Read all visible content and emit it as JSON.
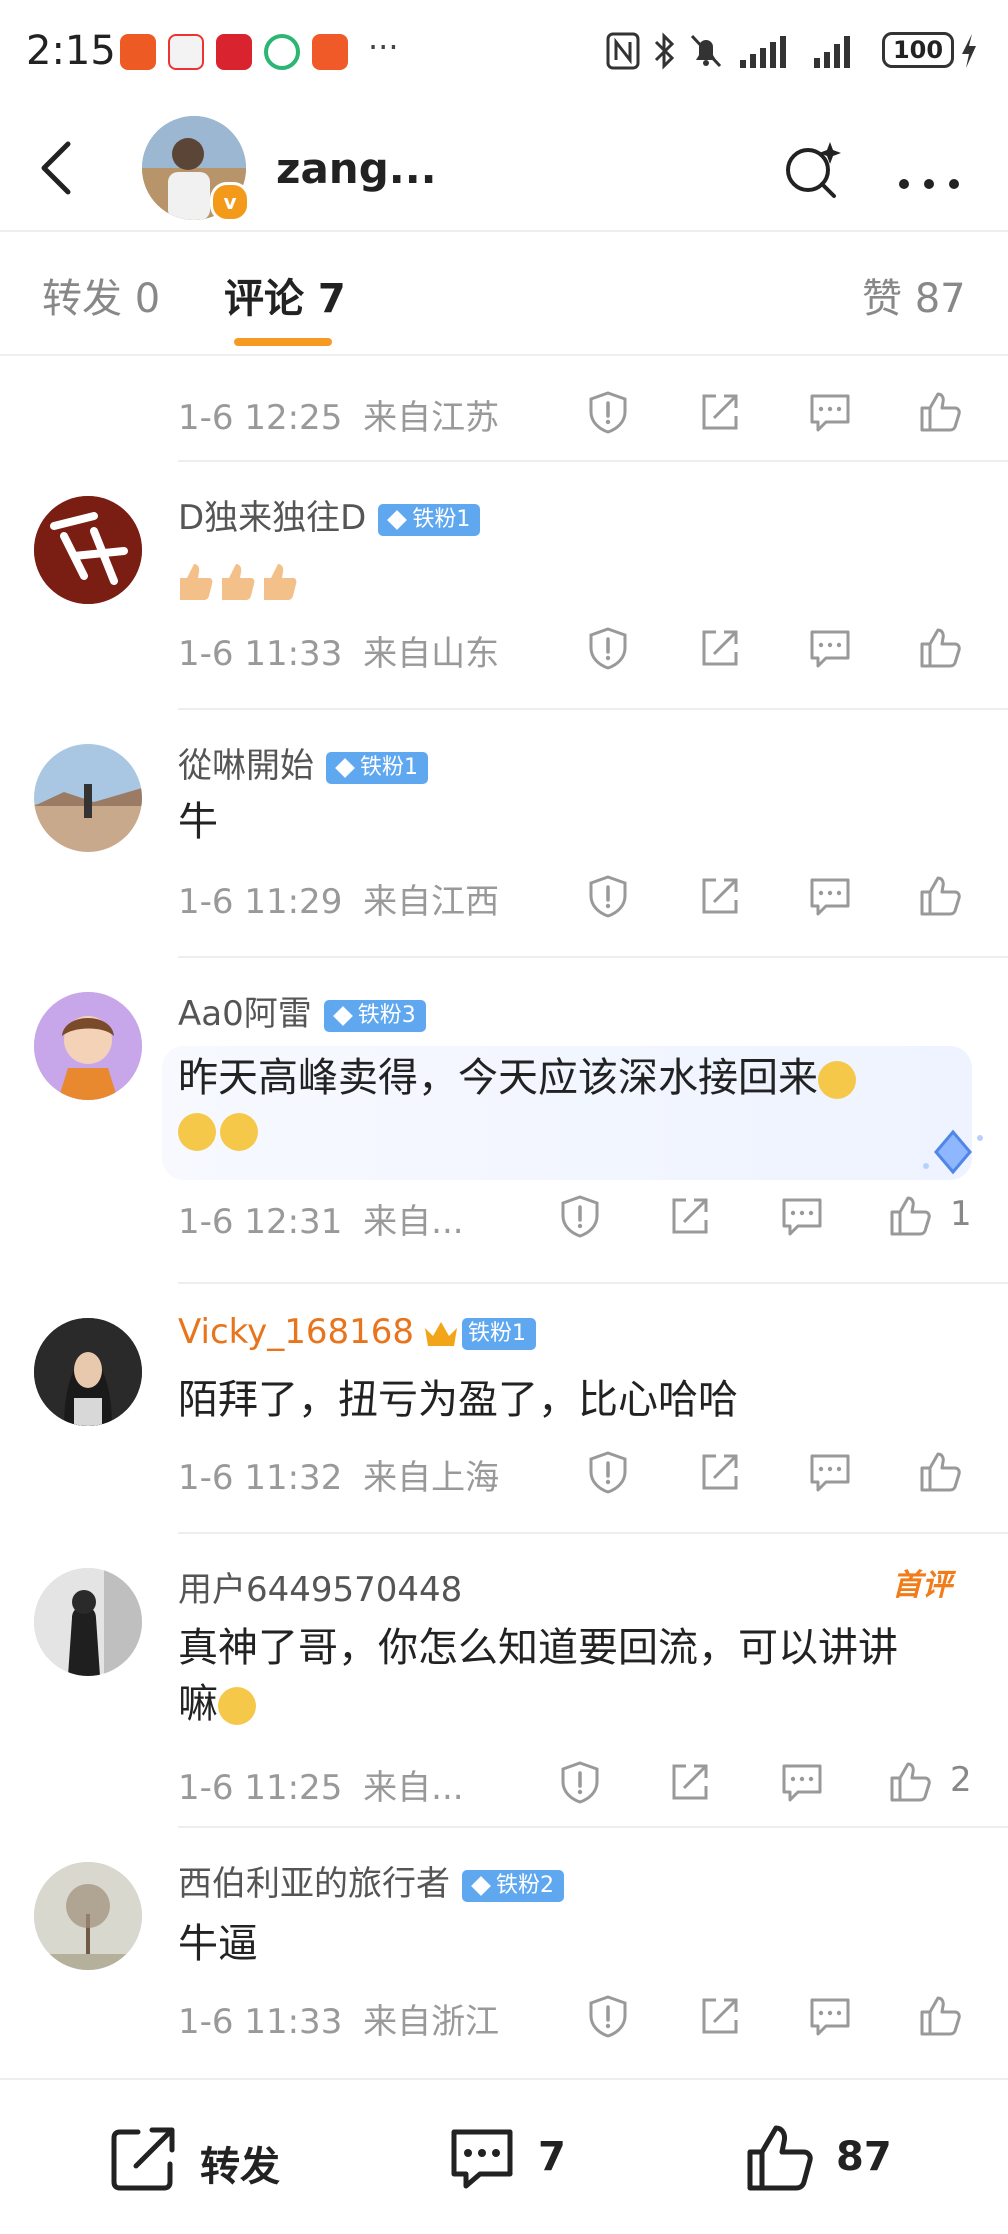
{
  "status_bar": {
    "time": "2:15",
    "more": "···",
    "battery": "100"
  },
  "header": {
    "username": "zang...",
    "verified": "v"
  },
  "tabs": [
    {
      "label": "转发 0"
    },
    {
      "label": "评论 7"
    },
    {
      "label": "赞 87"
    }
  ],
  "comments": [
    {
      "name": "",
      "text": "",
      "time": "1-6 12:25",
      "location": "来自江苏",
      "likes": ""
    },
    {
      "name": "D独来独往D",
      "fan": "铁粉1",
      "text": "",
      "time": "1-6 11:33",
      "location": "来自山东",
      "likes": ""
    },
    {
      "name": "從啉開始",
      "fan": "铁粉1",
      "text": "牛",
      "time": "1-6 11:29",
      "location": "来自江西",
      "likes": ""
    },
    {
      "name": "Aa0阿雷",
      "fan": "铁粉3",
      "text_line1": "昨天高峰卖得，今天应该深水接回来",
      "time": "1-6 12:31",
      "location": "来自...",
      "likes": "1"
    },
    {
      "name": "Vicky_168168",
      "fan": "铁粉1",
      "text": "陌拜了，扭亏为盈了，比心哈哈",
      "time": "1-6 11:32",
      "location": "来自上海",
      "likes": ""
    },
    {
      "name": "用户6449570448",
      "badge": "首评",
      "text_line1": "真神了哥，你怎么知道要回流，可以讲讲",
      "text_line2": "嘛",
      "time": "1-6 11:25",
      "location": "来自...",
      "likes": "2"
    },
    {
      "name": "西伯利亚的旅行者",
      "fan": "铁粉2",
      "text": "牛逼",
      "time": "1-6 11:33",
      "location": "来自浙江",
      "likes": ""
    }
  ],
  "bottom_bar": {
    "repost_label": "转发",
    "comment_count": "7",
    "like_count": "87"
  },
  "colors": {
    "accent": "#f59a23",
    "fan_badge": "#5fa8f0",
    "vip_name": "#e8741c"
  }
}
